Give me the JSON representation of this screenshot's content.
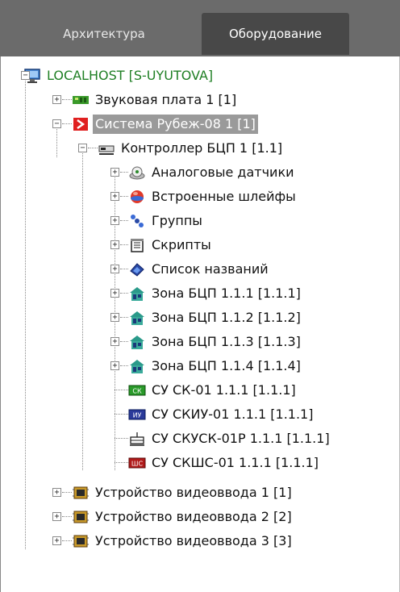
{
  "tabs": [
    {
      "label": "Архитектура",
      "active": false
    },
    {
      "label": "Оборудование",
      "active": true
    }
  ],
  "tree": {
    "root": {
      "label": "LOCALHOST [S-UYUTOVA]",
      "icon": "monitor-icon"
    },
    "items": [
      {
        "label": "Звуковая плата 1 [1]",
        "icon": "sound-card-icon"
      },
      {
        "label": "Система Рубеж-08 1 [1]",
        "icon": "rubezh-system-icon",
        "selected": true
      },
      {
        "label": "Контроллер БЦП 1 [1.1]",
        "icon": "controller-icon"
      },
      {
        "label": "Аналоговые датчики",
        "icon": "analog-sensor-icon"
      },
      {
        "label": "Встроенные шлейфы",
        "icon": "loop-icon"
      },
      {
        "label": "Группы",
        "icon": "groups-icon"
      },
      {
        "label": "Скрипты",
        "icon": "scripts-icon"
      },
      {
        "label": "Список названий",
        "icon": "names-list-icon"
      },
      {
        "label": "Зона БЦП 1.1.1 [1.1.1]",
        "icon": "zone-icon"
      },
      {
        "label": "Зона БЦП 1.1.2 [1.1.2]",
        "icon": "zone-icon"
      },
      {
        "label": "Зона БЦП 1.1.3 [1.1.3]",
        "icon": "zone-icon"
      },
      {
        "label": "Зона БЦП 1.1.4 [1.1.4]",
        "icon": "zone-icon"
      },
      {
        "label": "СУ СК-01 1.1.1 [1.1.1]",
        "icon": "sk-icon",
        "badge": "СК"
      },
      {
        "label": "СУ СКИУ-01 1.1.1 [1.1.1]",
        "icon": "skiu-icon",
        "badge": "ИУ"
      },
      {
        "label": "СУ СКУСК-01Р 1.1.1 [1.1.1]",
        "icon": "skusk-icon"
      },
      {
        "label": "СУ СКШС-01 1.1.1 [1.1.1]",
        "icon": "skshs-icon",
        "badge": "ШС"
      },
      {
        "label": "Устройство видеоввода 1 [1]",
        "icon": "video-input-icon"
      },
      {
        "label": "Устройство видеоввода 2 [2]",
        "icon": "video-input-icon"
      },
      {
        "label": "Устройство видеоввода 3 [3]",
        "icon": "video-input-icon"
      }
    ]
  },
  "colors": {
    "root_text": "#1f7f24",
    "selection_bg": "#9a9a9a",
    "tabbar_bg": "#6b6b6b",
    "active_tab_bg": "#484848"
  }
}
